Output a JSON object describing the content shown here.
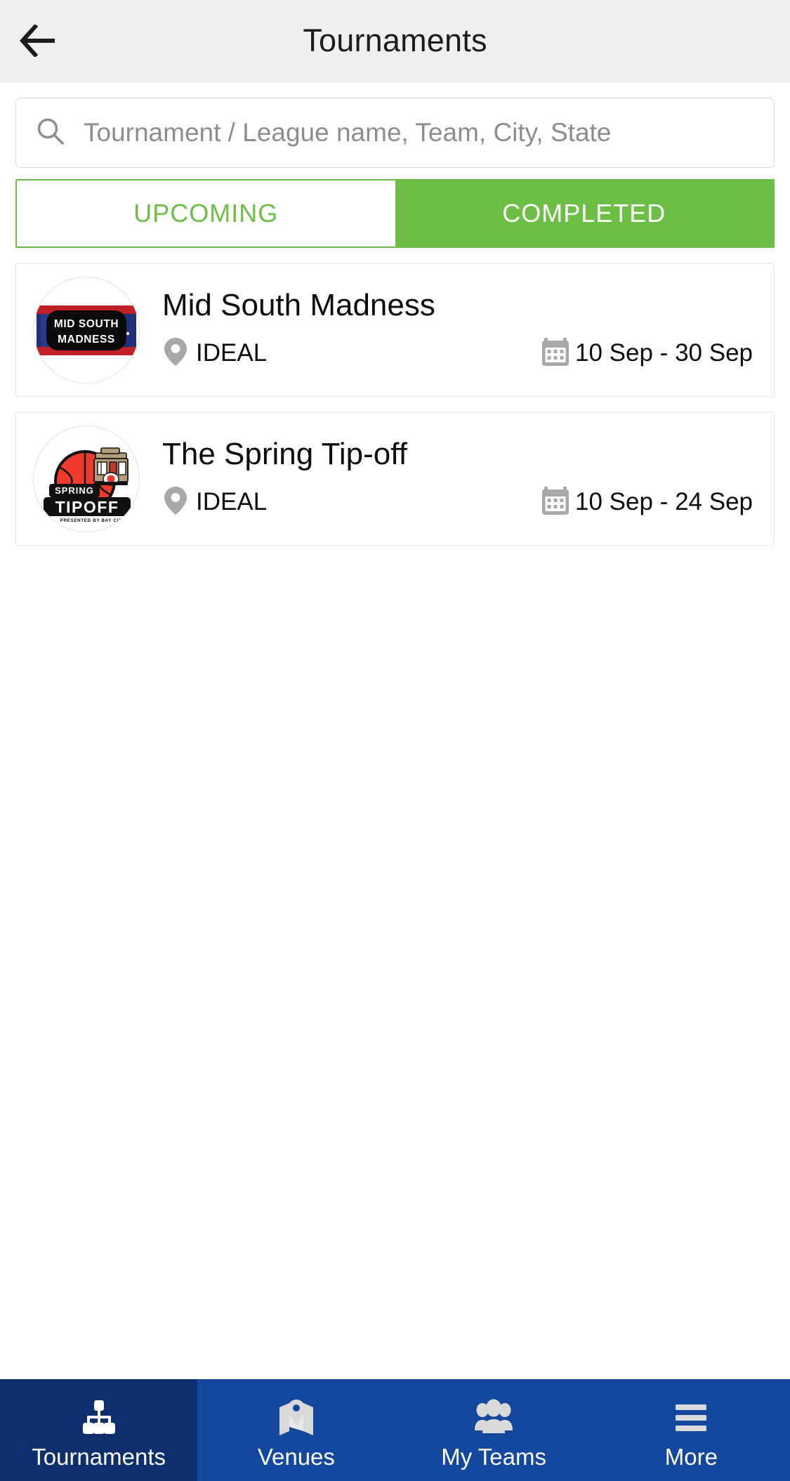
{
  "header": {
    "title": "Tournaments",
    "back_icon": "arrow-left-icon"
  },
  "search": {
    "icon": "search-icon",
    "placeholder": "Tournament / League name, Team, City, State",
    "value": ""
  },
  "tabs": {
    "upcoming": {
      "label": "UPCOMING",
      "active": false
    },
    "completed": {
      "label": "COMPLETED",
      "active": true
    },
    "active_color": "#6cbe45"
  },
  "tournaments": [
    {
      "name": "Mid South Madness",
      "logo_alt": "MID SOUTH MADNESS",
      "logo_line1": "MID SOUTH",
      "logo_line2": "MADNESS",
      "location_icon": "location-pin-icon",
      "location": "IDEAL",
      "date_icon": "calendar-icon",
      "dates": "10 Sep - 30 Sep"
    },
    {
      "name": "The Spring Tip-off",
      "logo_alt": "SPRING TIPOFF PRESENTED BY BAY CITY",
      "logo_line1": "SPRING",
      "logo_line2": "TIPOFF",
      "logo_line3": "PRESENTED BY BAY CITY",
      "location_icon": "location-pin-icon",
      "location": "IDEAL",
      "date_icon": "calendar-icon",
      "dates": "10 Sep - 24 Sep"
    }
  ],
  "bottom_nav": [
    {
      "label": "Tournaments",
      "icon": "bracket-icon",
      "active": true
    },
    {
      "label": "Venues",
      "icon": "map-pin-icon",
      "active": false
    },
    {
      "label": "My Teams",
      "icon": "people-icon",
      "active": false
    },
    {
      "label": "More",
      "icon": "hamburger-icon",
      "active": false
    }
  ],
  "colors": {
    "accent_green": "#6cbe45",
    "nav_blue": "#14479e",
    "nav_blue_active": "#0d2f6d",
    "appbar_bg": "#efefef"
  }
}
